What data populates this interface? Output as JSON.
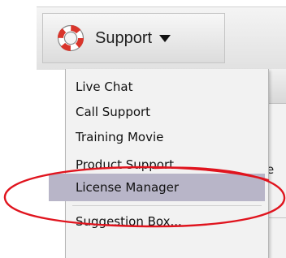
{
  "toolbar": {
    "support_label": "Support",
    "icons": {
      "support": "lifebuoy-icon",
      "dropdown": "caret-down-icon"
    }
  },
  "menu": {
    "items": [
      {
        "label": "Live Chat"
      },
      {
        "label": "Call Support"
      },
      {
        "label": "Training Movie"
      },
      {
        "label": "Product Support"
      },
      {
        "label": "License Manager",
        "selected": true
      },
      {
        "label": "Suggestion Box..."
      }
    ]
  },
  "background": {
    "peek_text": "e"
  },
  "colors": {
    "selection": "#b8b5c8",
    "highlight_ellipse": "#e0141e",
    "lifebuoy_red": "#d9352b"
  }
}
